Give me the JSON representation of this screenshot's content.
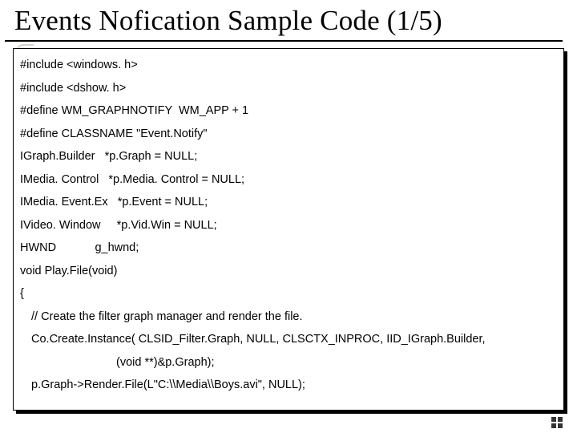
{
  "title": "Events Nofication Sample Code (1/5)",
  "code": {
    "l1": "#include <windows. h>",
    "l2": "#include <dshow. h>",
    "l3": "#define WM_GRAPHNOTIFY  WM_APP + 1",
    "l4": "#define CLASSNAME \"Event.Notify\"",
    "l5": "IGraph.Builder   *p.Graph = NULL;",
    "l6": "IMedia. Control   *p.Media. Control = NULL;",
    "l7": "IMedia. Event.Ex   *p.Event = NULL;",
    "l8": "IVideo. Window     *p.Vid.Win = NULL;",
    "l9": "HWND            g_hwnd;",
    "l10": "void Play.File(void)",
    "l11": "{",
    "l12": "// Create the filter graph manager and render the file.",
    "l13": "Co.Create.Instance(         CLSID_Filter.Graph, NULL, CLSCTX_INPROC, IID_IGraph.Builder,",
    "l14": "(void **)&p.Graph);",
    "l15": "p.Graph->Render.File(L\"C:\\\\Media\\\\Boys.avi\", NULL);"
  }
}
